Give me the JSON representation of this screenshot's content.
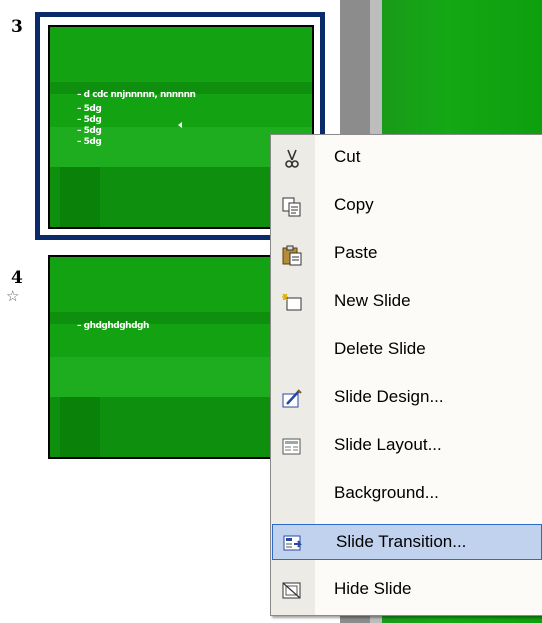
{
  "thumbnails": [
    {
      "number": "3",
      "bullets": [
        "– d  cdc nnjnnnnn, nnnnnn",
        "– 5dg",
        "– 5dg",
        "– 5dg",
        "– 5dg"
      ]
    },
    {
      "number": "4",
      "bullets": [
        "– ghdghdghdgh"
      ]
    }
  ],
  "context_menu": {
    "items": [
      {
        "label": "Cut",
        "icon": "scissors-icon"
      },
      {
        "label": "Copy",
        "icon": "copy-icon"
      },
      {
        "label": "Paste",
        "icon": "paste-icon"
      },
      {
        "label": "New Slide",
        "icon": "new-slide-icon"
      },
      {
        "label": "Delete Slide",
        "icon": ""
      },
      {
        "label": "Slide Design...",
        "icon": "slide-design-icon"
      },
      {
        "label": "Slide Layout...",
        "icon": "slide-layout-icon"
      },
      {
        "label": "Background...",
        "icon": ""
      },
      {
        "label": "Slide Transition...",
        "icon": "slide-transition-icon"
      },
      {
        "label": "Hide Slide",
        "icon": "hide-slide-icon"
      }
    ],
    "highlighted": "Slide Transition..."
  }
}
